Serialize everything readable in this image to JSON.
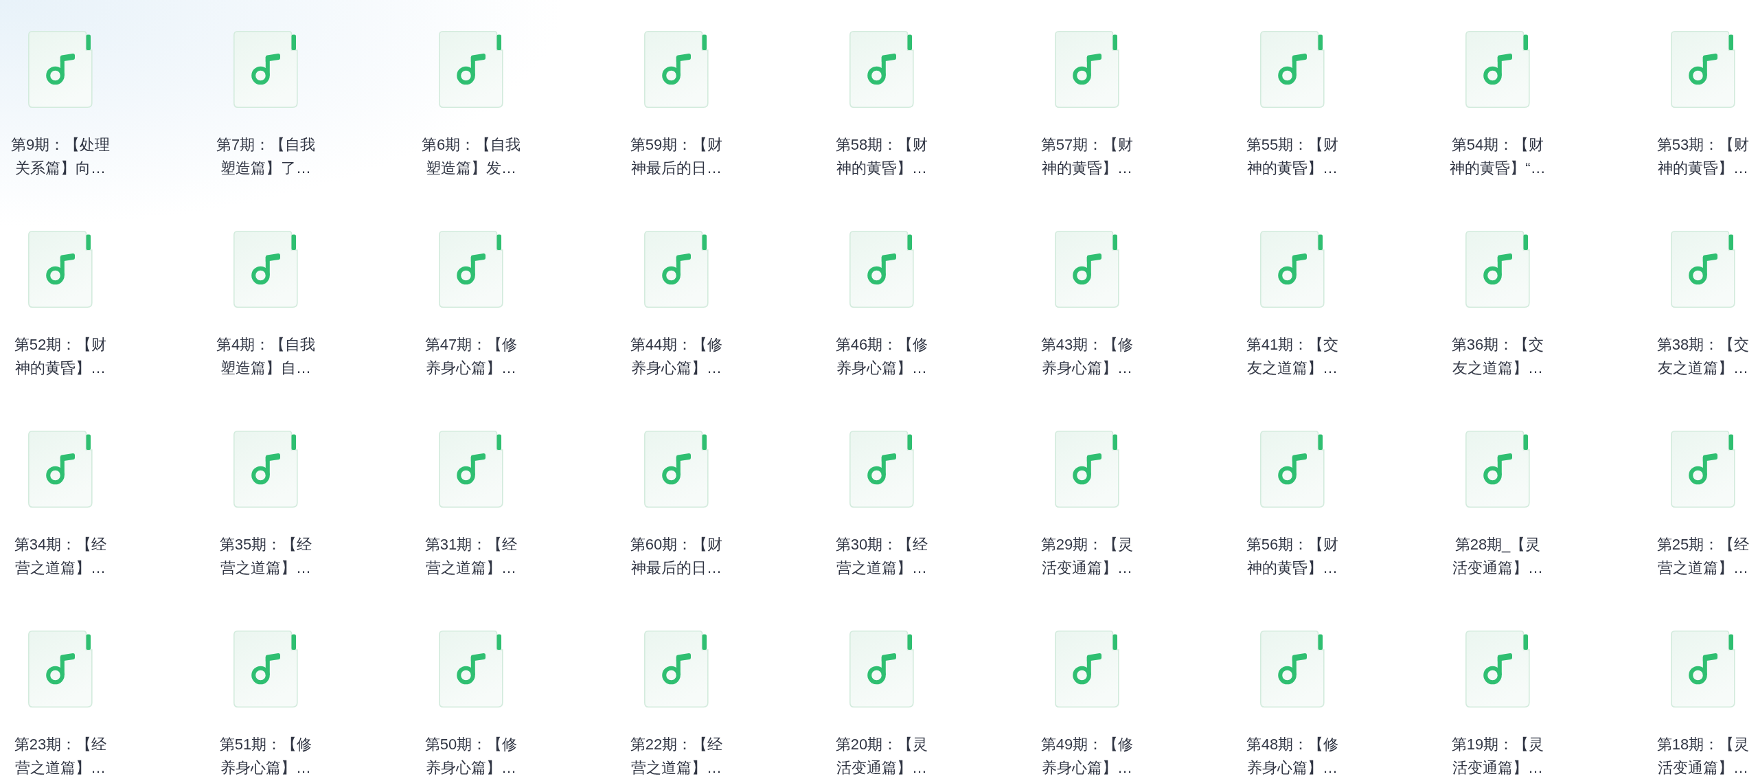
{
  "files": [
    {
      "label": "第9期：【处理关系篇】向…"
    },
    {
      "label": "第7期：【自我塑造篇】了…"
    },
    {
      "label": "第6期：【自我塑造篇】发…"
    },
    {
      "label": "第59期：【财神最后的日…"
    },
    {
      "label": "第58期：【财神的黄昏】…"
    },
    {
      "label": "第57期：【财神的黄昏】…"
    },
    {
      "label": "第55期：【财神的黄昏】…"
    },
    {
      "label": "第54期：【财神的黄昏】“…"
    },
    {
      "label": "第53期：【财神的黄昏】…"
    },
    {
      "label": "第52期：【财神的黄昏】…"
    },
    {
      "label": "第4期：【自我塑造篇】自…"
    },
    {
      "label": "第47期：【修养身心篇】…"
    },
    {
      "label": "第44期：【修养身心篇】…"
    },
    {
      "label": "第46期：【修养身心篇】…"
    },
    {
      "label": "第43期：【修养身心篇】…"
    },
    {
      "label": "第41期：【交友之道篇】…"
    },
    {
      "label": "第36期：【交友之道篇】…"
    },
    {
      "label": "第38期：【交友之道篇】…"
    },
    {
      "label": "第34期：【经营之道篇】…"
    },
    {
      "label": "第35期：【经营之道篇】…"
    },
    {
      "label": "第31期：【经营之道篇】…"
    },
    {
      "label": "第60期：【财神最后的日…"
    },
    {
      "label": "第30期：【经营之道篇】…"
    },
    {
      "label": "第29期：【灵活变通篇】…"
    },
    {
      "label": "第56期：【财神的黄昏】…"
    },
    {
      "label": "第28期_【灵活变通篇】…"
    },
    {
      "label": "第25期：【经营之道篇】…"
    },
    {
      "label": "第23期：【经营之道篇】…"
    },
    {
      "label": "第51期：【修养身心篇】…"
    },
    {
      "label": "第50期：【修养身心篇】…"
    },
    {
      "label": "第22期：【经营之道篇】…"
    },
    {
      "label": "第20期：【灵活变通篇】…"
    },
    {
      "label": "第49期：【修养身心篇】…"
    },
    {
      "label": "第48期：【修养身心篇】…"
    },
    {
      "label": "第19期：【灵活变通篇】…"
    },
    {
      "label": "第18期：【灵活变通篇】…"
    }
  ]
}
